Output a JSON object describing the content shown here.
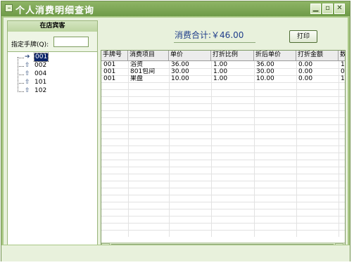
{
  "window": {
    "title": "个人消费明细查询",
    "buttons": {
      "minimize": "▁",
      "maximize": "▫",
      "close": "✕"
    }
  },
  "left_panel": {
    "header": "在店宾客",
    "filter_label": "指定手牌(Q):",
    "filter_value": "",
    "tree_items": [
      {
        "label": "001",
        "selected": true,
        "icon": "arrow-right-icon"
      },
      {
        "label": "002",
        "selected": false,
        "icon": "up-arrow-icon"
      },
      {
        "label": "004",
        "selected": false,
        "icon": "up-arrow-icon"
      },
      {
        "label": "101",
        "selected": false,
        "icon": "up-arrow-icon"
      },
      {
        "label": "102",
        "selected": false,
        "icon": "up-arrow-icon"
      }
    ]
  },
  "summary": {
    "total_label": "消费合计:￥46.00",
    "print_label": "打印"
  },
  "grid": {
    "columns": [
      "手牌号",
      "消费项目",
      "单价",
      "打折比例",
      "折后单价",
      "打折金额",
      "数"
    ],
    "rows": [
      [
        "001",
        "浴资",
        "36.00",
        "1.00",
        "36.00",
        "0.00",
        "1"
      ],
      [
        "001",
        "801包间",
        "30.00",
        "1.00",
        "30.00",
        "0.00",
        "0"
      ],
      [
        "001",
        "果盘",
        "10.00",
        "1.00",
        "10.00",
        "0.00",
        "1"
      ]
    ]
  },
  "colors": {
    "frame": "#a9c785",
    "selected": "#0a246a",
    "total_text": "#1f3d8a"
  }
}
